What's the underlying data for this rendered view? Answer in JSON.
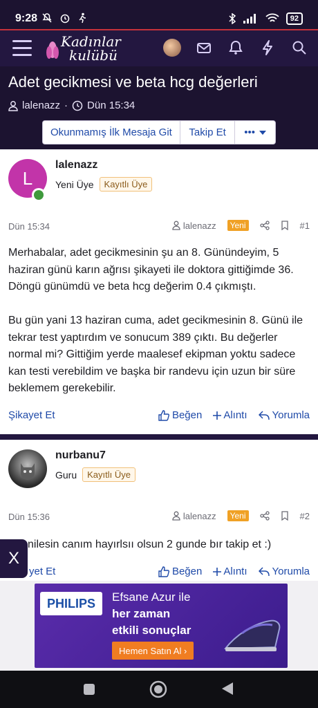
{
  "status": {
    "time": "9:28",
    "battery": "92"
  },
  "nav": {
    "logo_line1": "Kadınlar",
    "logo_line2": "kulübü"
  },
  "thread": {
    "title": "Adet gecikmesi ve beta hcg değerleri",
    "author": "lalenazz",
    "date": "Dün 15:34",
    "buttons": {
      "unread": "Okunmamış İlk Mesaja Git",
      "follow": "Takip Et",
      "more": "•••"
    }
  },
  "posts": [
    {
      "avatar_letter": "L",
      "avatar_color": "#c234a9",
      "username": "lalenazz",
      "role": "Yeni Üye",
      "badge": "Kayıtlı Üye",
      "date": "Dün 15:34",
      "author_ref": "lalenazz",
      "new_label": "Yeni",
      "number": "#1",
      "paragraphs": [
        "Merhabalar, adet gecikmesinin şu an 8. Günündeyim, 5 haziran günü karın ağrısı şikayeti ile doktora gittiğimde 36. Döngü günümdü ve beta hcg değerim 0.4 çıkmıştı.",
        "Bu gün yani 13 haziran cuma, adet gecikmesinin 8. Günü ile tekrar test yaptırdım ve sonucum 389 çıktı. Bu değerler normal mi? Gittiğim yerde maalesef ekipman yoktu sadece kan testi verebildim ve başka bir randevu için uzun bir süre beklemem gerekebilir."
      ],
      "actions": {
        "report": "Şikayet Et",
        "like": "Beğen",
        "quote": "Alıntı",
        "reply": "Yorumla"
      }
    },
    {
      "username": "nurbanu7",
      "role": "Guru",
      "badge": "Kayıtlı Üye",
      "date": "Dün 15:36",
      "author_ref": "lalenazz",
      "new_label": "Yeni",
      "number": "#2",
      "paragraphs": [
        "nilesin canım hayırlsıı olsun 2 gunde bır takip et :)"
      ],
      "actions": {
        "report": "yet Et",
        "like": "Beğen",
        "quote": "Alıntı",
        "reply": "Yorumla"
      }
    }
  ],
  "overlay": {
    "close": "X"
  },
  "ad": {
    "brand": "PHILIPS",
    "line1": "Efsane Azur ile",
    "line2": "her zaman",
    "line3": "etkili sonuçlar",
    "cta": "Hemen Satın Al ›"
  },
  "colors": {
    "header_bg": "#1c1330",
    "link": "#1f4aa8",
    "badge_new": "#f0a125"
  }
}
